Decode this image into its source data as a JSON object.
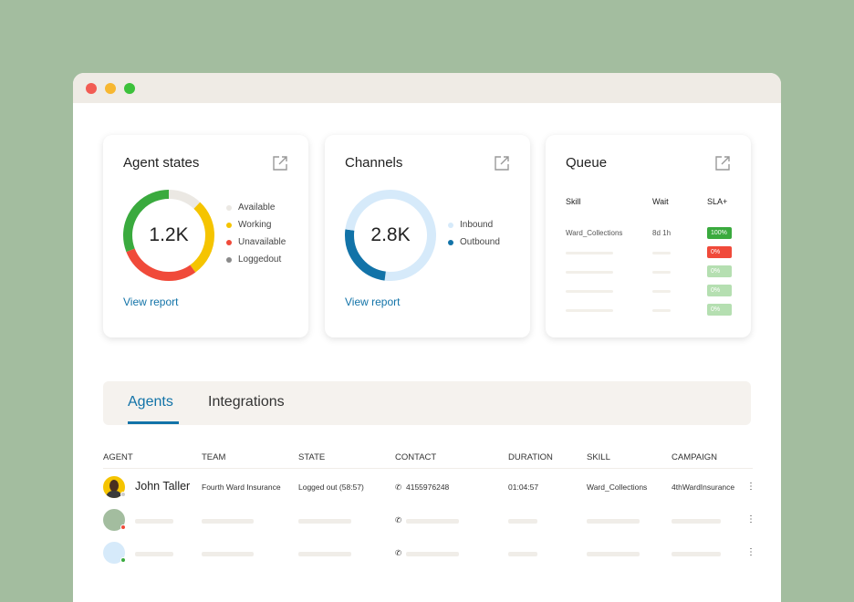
{
  "cards": {
    "agent_states": {
      "title": "Agent states",
      "total": "1.2K",
      "link": "View report",
      "legend": [
        {
          "label": "Available",
          "color": "#ebe8e3"
        },
        {
          "label": "Working",
          "color": "#f5c400"
        },
        {
          "label": "Unavailable",
          "color": "#f04a3a"
        },
        {
          "label": "Loggedout",
          "color": "#8a8a8a"
        }
      ],
      "segments": [
        {
          "fraction": 0.12,
          "color": "#ebe8e3"
        },
        {
          "fraction": 0.28,
          "color": "#f5c400"
        },
        {
          "fraction": 0.29,
          "color": "#f04a3a"
        },
        {
          "fraction": 0.31,
          "color": "#3aaa3e"
        }
      ]
    },
    "channels": {
      "title": "Channels",
      "total": "2.8K",
      "link": "View report",
      "legend": [
        {
          "label": "Inbound",
          "color": "#d6eafa"
        },
        {
          "label": "Outbound",
          "color": "#1273a8"
        }
      ],
      "segments": [
        {
          "fraction": 0.52,
          "color": "#d6eafa"
        },
        {
          "fraction": 0.25,
          "color": "#1273a8"
        },
        {
          "fraction": 0.23,
          "color": "#d6eafa"
        }
      ]
    },
    "queue": {
      "title": "Queue",
      "headers": [
        "Skill",
        "Wait",
        "SLA+"
      ],
      "rows": [
        {
          "skill": "Ward_Collections",
          "wait": "8d 1h",
          "sla": "100%",
          "color": "#3aaa3e"
        },
        {
          "sla": "0%",
          "color": "#f04a3a"
        },
        {
          "sla": "0%",
          "color": "#b5dfb1"
        },
        {
          "sla": "0%",
          "color": "#b5dfb1"
        },
        {
          "sla": "0%",
          "color": "#b5dfb1"
        }
      ]
    }
  },
  "tabs": [
    {
      "label": "Agents",
      "active": true
    },
    {
      "label": "Integrations",
      "active": false
    }
  ],
  "table": {
    "headers": [
      "AGENT",
      "TEAM",
      "STATE",
      "CONTACT",
      "DURATION",
      "SKILL",
      "CAMPAIGN"
    ],
    "rows": [
      {
        "agent": "John Taller",
        "team": "Fourth Ward Insurance",
        "state": "Logged out (58:57)",
        "contact": "4155976248",
        "duration": "01:04:57",
        "skill": "Ward_Collections",
        "campaign": "4thWardInsurance"
      }
    ]
  },
  "colors": {
    "accent": "#1273a8"
  }
}
